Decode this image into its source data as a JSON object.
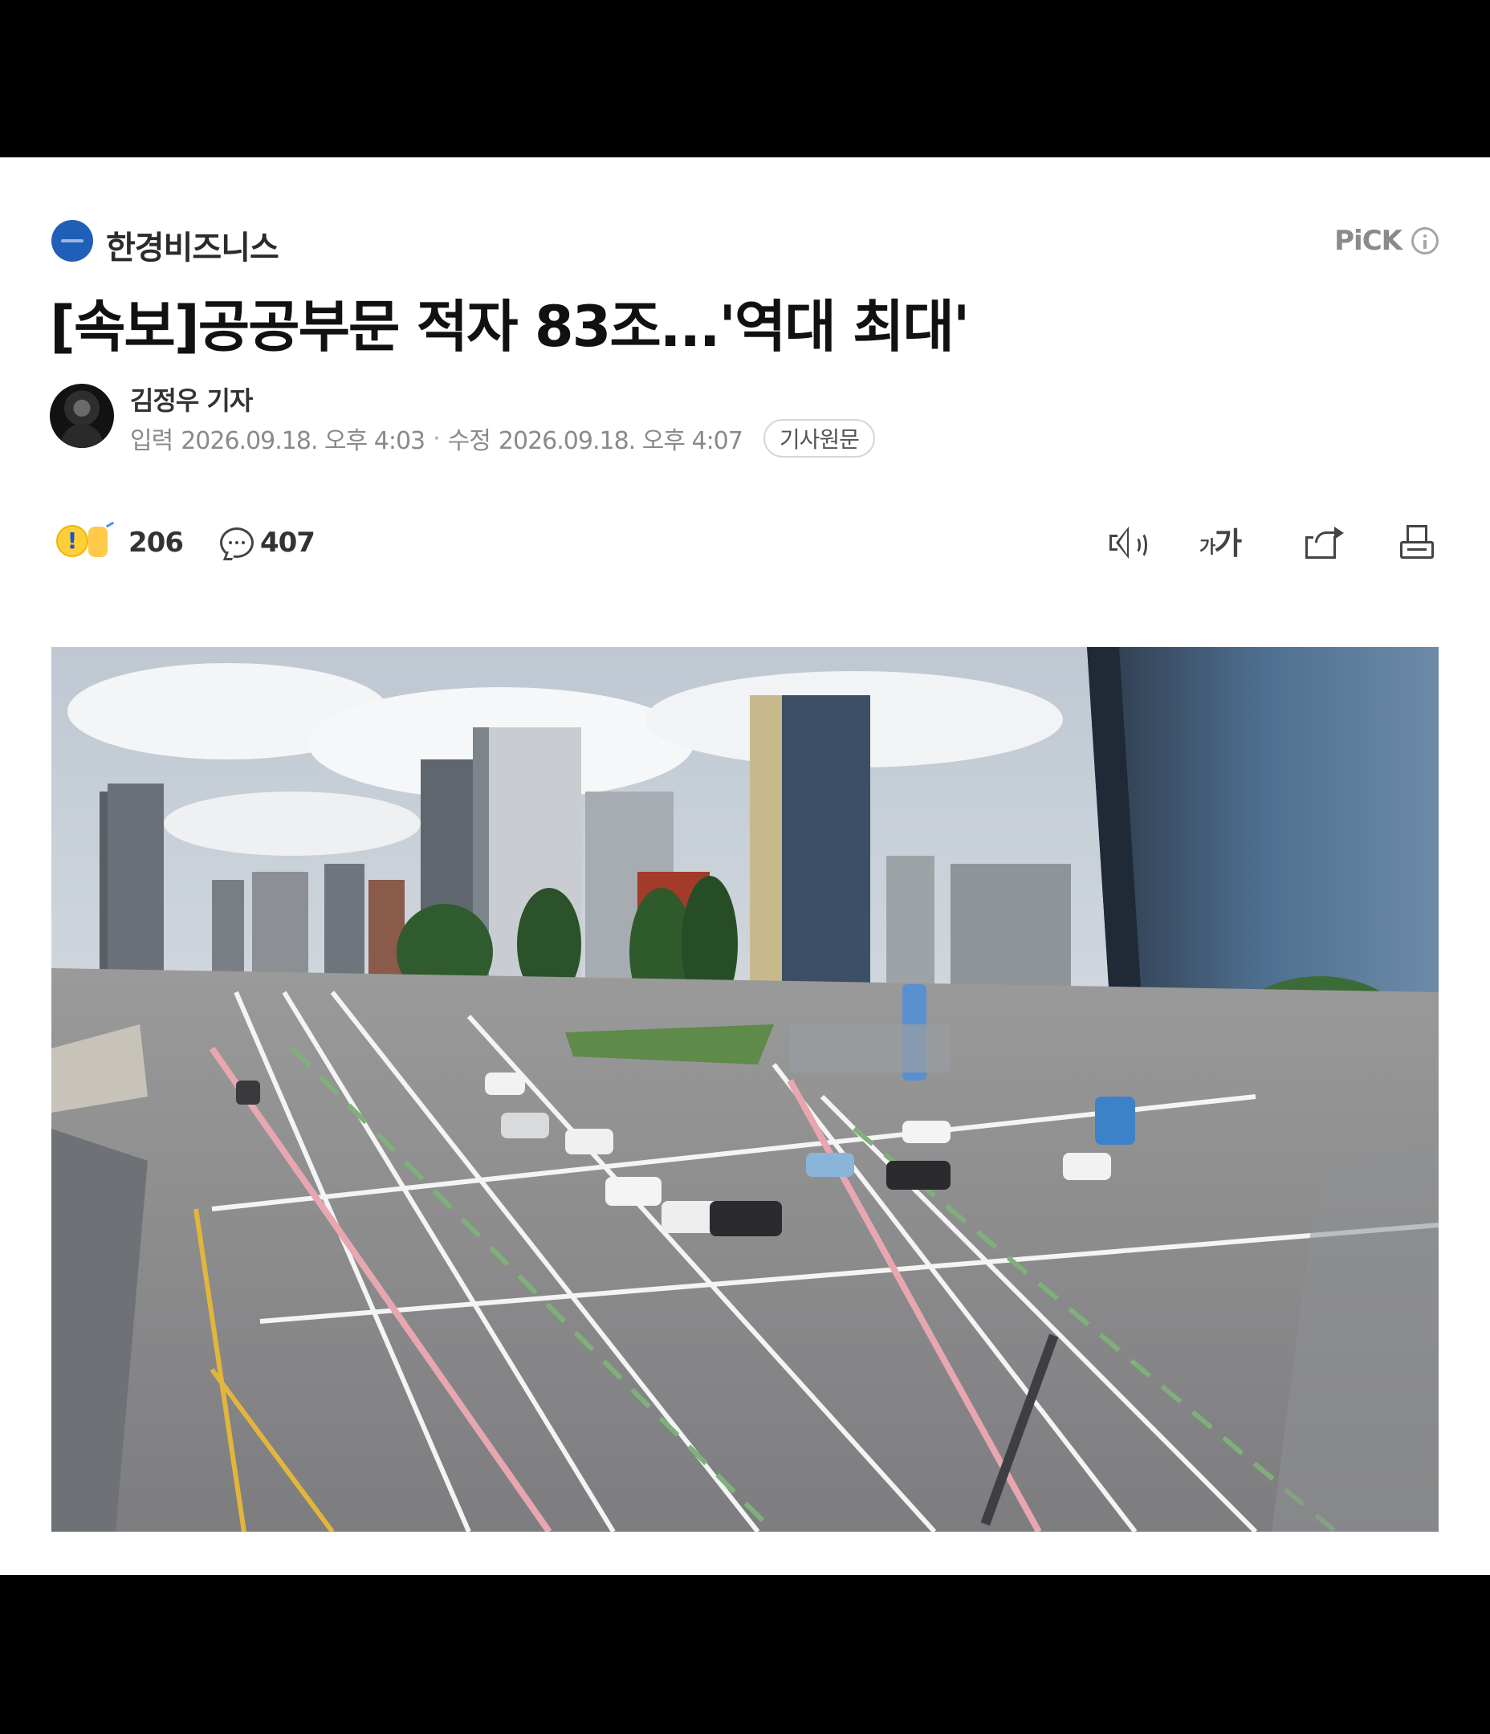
{
  "press": {
    "name": "한경비즈니스",
    "pick_label": "PiCK"
  },
  "article": {
    "headline": "[속보]공공부문 적자 83조...'역대 최대'",
    "reporter": "김정우 기자",
    "input_label": "입력",
    "input_datetime": "2026.09.18. 오후 4:03",
    "modified_label": "수정",
    "modified_datetime": "2026.09.18. 오후 4:07",
    "origin_button": "기사원문"
  },
  "reactions": {
    "reaction_count": "206",
    "comment_count": "407"
  },
  "toolbar": {
    "font_small": "가",
    "font_big": "가"
  },
  "colors": {
    "press_logo": "#1f5fb8",
    "text_primary": "#111111",
    "text_secondary": "#8a8a8a"
  },
  "icons": [
    "info-icon",
    "reaction-emoji-icon",
    "comment-icon",
    "speaker-icon",
    "font-size-icon",
    "share-icon",
    "print-icon"
  ]
}
